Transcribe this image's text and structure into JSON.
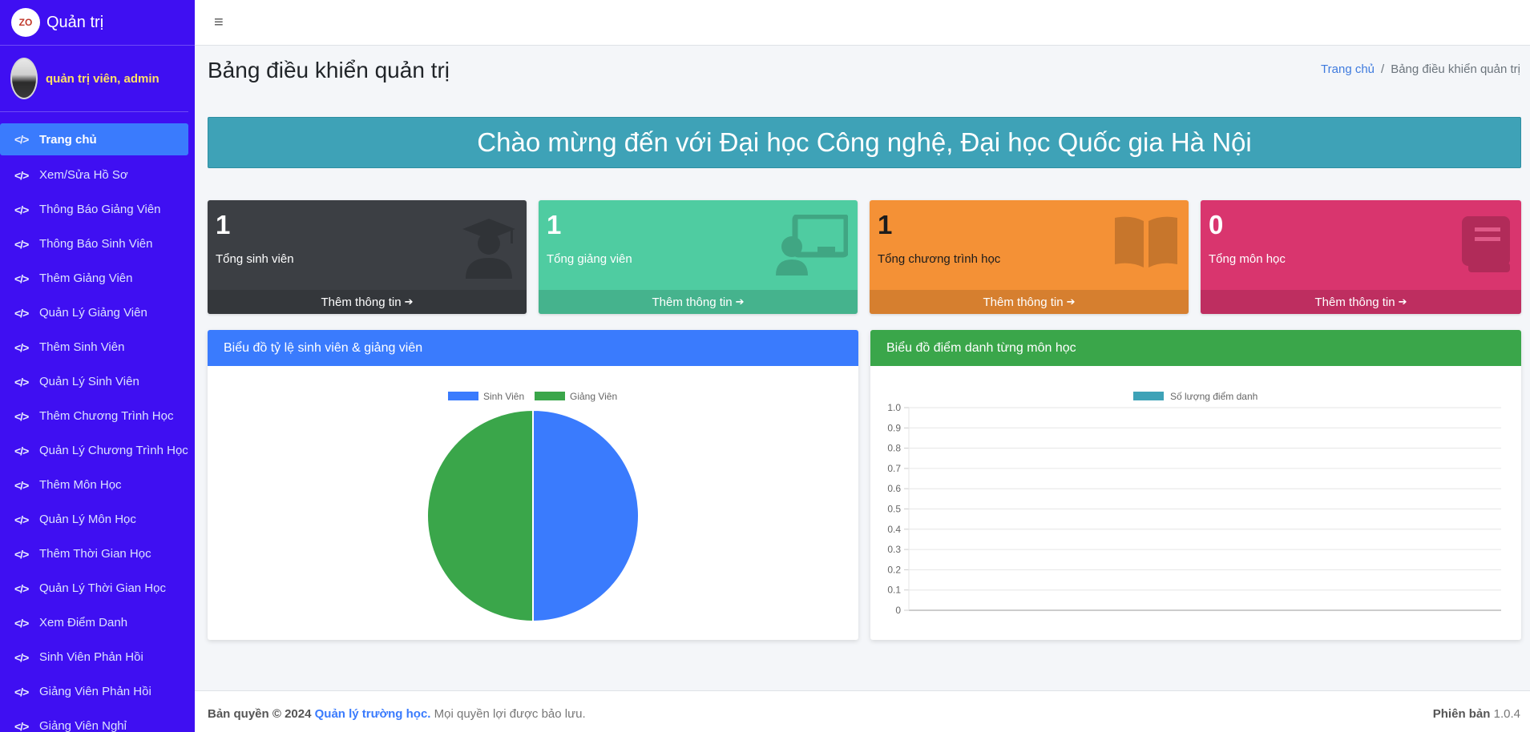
{
  "brand": {
    "logo_text": "ZO",
    "title": "Quản trị"
  },
  "user": {
    "name": "quản trị viên, admin"
  },
  "sidebar": {
    "items": [
      {
        "label": "Trang chủ"
      },
      {
        "label": "Xem/Sửa Hồ Sơ"
      },
      {
        "label": "Thông Báo Giảng Viên"
      },
      {
        "label": "Thông Báo Sinh Viên"
      },
      {
        "label": "Thêm Giảng Viên"
      },
      {
        "label": "Quản Lý Giảng Viên"
      },
      {
        "label": "Thêm Sinh Viên"
      },
      {
        "label": "Quản Lý Sinh Viên"
      },
      {
        "label": "Thêm Chương Trình Học"
      },
      {
        "label": "Quản Lý Chương Trình Học"
      },
      {
        "label": "Thêm Môn Học"
      },
      {
        "label": "Quản Lý Môn Học"
      },
      {
        "label": "Thêm Thời Gian Học"
      },
      {
        "label": "Quản Lý Thời Gian Học"
      },
      {
        "label": "Xem Điểm Danh"
      },
      {
        "label": "Sinh Viên Phản Hồi"
      },
      {
        "label": "Giảng Viên Phản Hồi"
      },
      {
        "label": "Giảng Viên Nghỉ"
      }
    ],
    "icon": "</>"
  },
  "topbar": {
    "menu_icon": "≡"
  },
  "header": {
    "title": "Bảng điều khiển quản trị",
    "breadcrumb_home": "Trang chủ",
    "breadcrumb_sep": "/",
    "breadcrumb_current": "Bảng điều khiển quản trị"
  },
  "banner": {
    "text": "Chào mừng đến với Đại học Công nghệ, Đại học Quốc gia Hà Nội"
  },
  "stats": [
    {
      "value": "1",
      "label": "Tổng sinh viên",
      "link": "Thêm thông tin",
      "icon": "graduate-icon"
    },
    {
      "value": "1",
      "label": "Tổng giảng viên",
      "link": "Thêm thông tin",
      "icon": "teacher-icon"
    },
    {
      "value": "1",
      "label": "Tổng chương trình học",
      "link": "Thêm thông tin",
      "icon": "book-open-icon"
    },
    {
      "value": "0",
      "label": "Tổng môn học",
      "link": "Thêm thông tin",
      "icon": "book-icon"
    }
  ],
  "colors": {
    "sidebar": "#3f0ff2",
    "active": "#3a7bfd",
    "banner": "#3ea2b7",
    "box_dark": "#3c3f44",
    "box_green": "#4fcca1",
    "box_orange": "#f49136",
    "box_pink": "#d9356e",
    "pie_blue": "#3a7bfd",
    "pie_green": "#3aa64a"
  },
  "cards": {
    "pie_title": "Biểu đồ tỷ lệ sinh viên & giảng viên",
    "bar_title": "Biểu đồ điểm danh từng môn học"
  },
  "chart_data": [
    {
      "type": "pie",
      "categories": [
        "Sinh Viên",
        "Giảng Viên"
      ],
      "values": [
        1,
        1
      ],
      "colors": [
        "#3a7bfd",
        "#3aa64a"
      ],
      "legend": "top"
    },
    {
      "type": "bar",
      "categories": [],
      "series": [
        {
          "name": "Số lượng điểm danh",
          "values": []
        }
      ],
      "ylim": [
        0,
        1.0
      ],
      "yticks": [
        "0",
        "0.1",
        "0.2",
        "0.3",
        "0.4",
        "0.5",
        "0.6",
        "0.7",
        "0.8",
        "0.9",
        "1.0"
      ],
      "grid": true,
      "legend": "top",
      "color": "#3ea2b7"
    }
  ],
  "footer": {
    "copyright_prefix": "Bản quyền © 2024",
    "org": "Quản lý trường học.",
    "rights": "Mọi quyền lợi được bảo lưu.",
    "version_label": "Phiên bản",
    "version": "1.0.4"
  }
}
